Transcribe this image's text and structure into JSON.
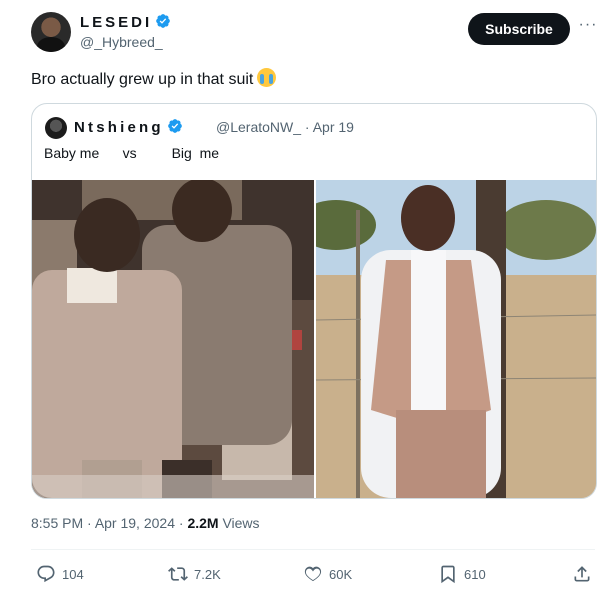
{
  "author": {
    "display_name": "LESEDI",
    "handle": "@_Hybreed_",
    "verified": true
  },
  "subscribe_label": "Subscribe",
  "more_icon": "more-horizontal-icon",
  "tweet": {
    "text": "Bro actually grew up in that suit",
    "emoji": "loudly-crying-face"
  },
  "quoted": {
    "display_name": "Ntshieng",
    "handle": "@LeratoNW_",
    "date": "Apr 19",
    "text": "Baby me      vs         Big  me",
    "images": [
      "baby-photo",
      "adult-photo"
    ]
  },
  "meta": {
    "time": "8:55 PM",
    "date": "Apr 19, 2024",
    "views_count": "2.2M",
    "views_label": "Views"
  },
  "actions": {
    "replies": "104",
    "reposts": "7.2K",
    "likes": "60K",
    "bookmarks": "610"
  },
  "colors": {
    "verified_blue": "#1d9bf0",
    "text_primary": "#0f1419",
    "text_secondary": "#536471",
    "border": "#cfd9de"
  }
}
